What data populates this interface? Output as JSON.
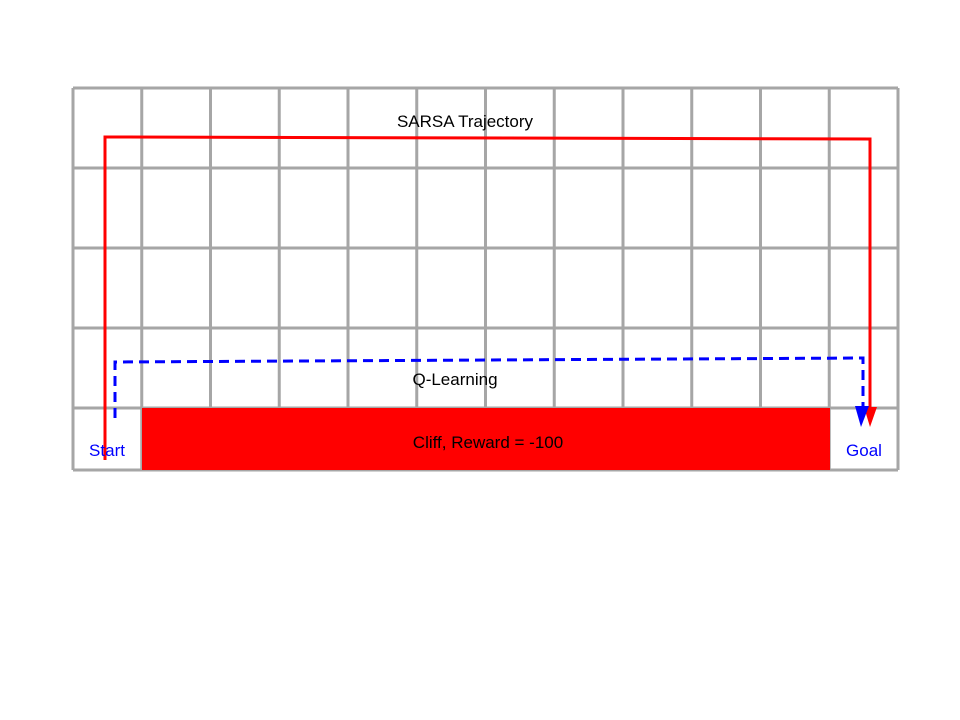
{
  "grid": {
    "columns": 12,
    "rows": 4,
    "line_color": "#a6a6a6"
  },
  "labels": {
    "sarsa": "SARSA Trajectory",
    "qlearning": "Q-Learning",
    "cliff": "Cliff, Reward = -100",
    "start": "Start",
    "goal": "Goal"
  },
  "colors": {
    "sarsa_path": "#ff0000",
    "qlearning_path": "#0000ff",
    "cliff_fill": "#ff0000",
    "start_goal_text": "#0000ff",
    "text": "#000000"
  },
  "icons": {
    "sarsa_arrow": "arrow-down-icon",
    "qlearning_arrow": "arrow-down-icon"
  }
}
